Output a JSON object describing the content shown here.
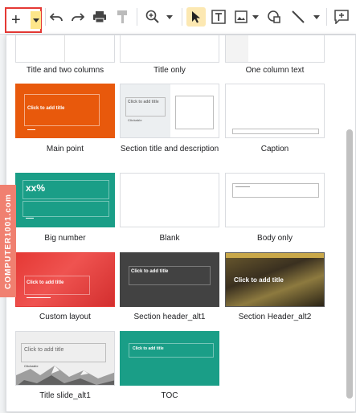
{
  "toolbar": {
    "new_slide": "+",
    "buttons": [
      "undo-icon",
      "redo-icon",
      "print-icon",
      "paint-format-icon",
      "zoom-icon",
      "select-icon",
      "textbox-icon",
      "image-icon",
      "shape-icon",
      "line-icon",
      "comment-icon"
    ]
  },
  "layouts": [
    {
      "label": "Title and two columns"
    },
    {
      "label": "Title only"
    },
    {
      "label": "One column text"
    },
    {
      "label": "Main point",
      "thumb_text": "Click to add title"
    },
    {
      "label": "Section title and description",
      "thumb_text": "Click to add title",
      "thumb_sub": "Clickable"
    },
    {
      "label": "Caption"
    },
    {
      "label": "Big number",
      "thumb_text": "xx%"
    },
    {
      "label": "Blank"
    },
    {
      "label": "Body only"
    },
    {
      "label": "Custom layout",
      "thumb_text": "Click to add title"
    },
    {
      "label": "Section header_alt1",
      "thumb_text": "Click to add title"
    },
    {
      "label": "Section Header_alt2",
      "thumb_text": "Click to add title"
    },
    {
      "label": "Title slide_alt1",
      "thumb_text": "Click to add title",
      "thumb_sub": "Clickable"
    },
    {
      "label": "TOC",
      "thumb_text": "Click to add title"
    }
  ],
  "watermark": "COMPUTER1001.com",
  "colors": {
    "orange": "#e8590c",
    "teal": "#1a9e87",
    "red": "#e03a3a",
    "dark": "#424242",
    "highlight": "#fce8b2"
  }
}
